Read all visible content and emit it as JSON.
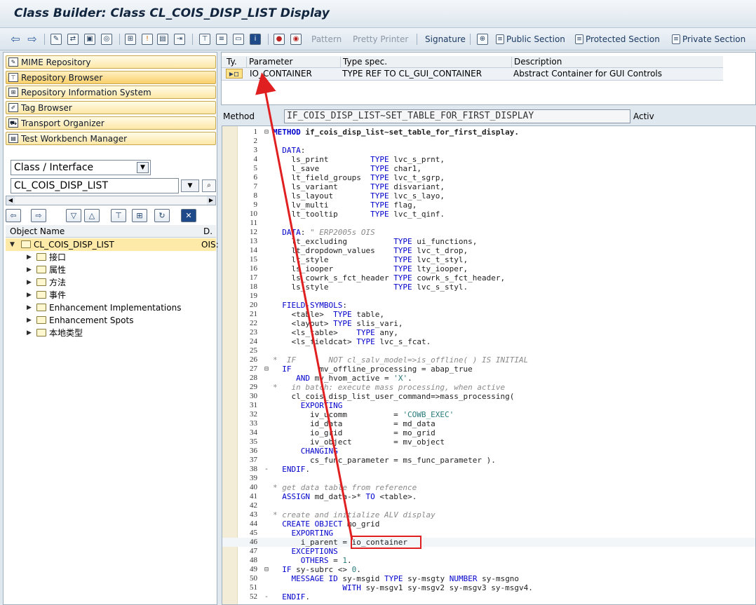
{
  "title": "Class Builder: Class CL_COIS_DISP_LIST Display",
  "toolbar": {
    "pattern": "Pattern",
    "pretty_printer": "Pretty Printer",
    "signature": "Signature",
    "public_section": "Public Section",
    "protected_section": "Protected Section",
    "private_section": "Private Section"
  },
  "nav": [
    {
      "label": "MIME Repository"
    },
    {
      "label": "Repository Browser"
    },
    {
      "label": "Repository Information System"
    },
    {
      "label": "Tag Browser"
    },
    {
      "label": "Transport Organizer"
    },
    {
      "label": "Test Workbench Manager"
    }
  ],
  "browser": {
    "object_type": "Class / Interface",
    "object_name": "CL_COIS_DISP_LIST"
  },
  "tree": {
    "col_name": "Object Name",
    "col_desc": "D.",
    "root": {
      "label": "CL_COIS_DISP_LIST",
      "desc": "OIS:"
    },
    "children": [
      {
        "label": "接口"
      },
      {
        "label": "属性"
      },
      {
        "label": "方法"
      },
      {
        "label": "事件"
      },
      {
        "label": "Enhancement Implementations"
      },
      {
        "label": "Enhancement Spots"
      },
      {
        "label": "本地类型"
      }
    ]
  },
  "params": {
    "headers": {
      "ty": "Ty.",
      "parameter": "Parameter",
      "type_spec": "Type spec.",
      "description": "Description"
    },
    "rows": [
      {
        "parameter": "IO_CONTAINER",
        "type_spec": "TYPE REF TO CL_GUI_CONTAINER",
        "description": "Abstract Container for GUI Controls"
      }
    ]
  },
  "method": {
    "label": "Method",
    "name": "IF_COIS_DISP_LIST~SET_TABLE_FOR_FIRST_DISPLAY",
    "status": "Activ"
  },
  "code_lines": [
    {
      "n": "1",
      "mk": "⊟",
      "t": "METHOD if_cois_disp_list~set_table_for_first_display."
    },
    {
      "n": "2",
      "mk": "",
      "t": ""
    },
    {
      "n": "3",
      "mk": "",
      "t": "  DATA:"
    },
    {
      "n": "4",
      "mk": "",
      "t": "    ls_print         TYPE lvc_s_prnt,"
    },
    {
      "n": "5",
      "mk": "",
      "t": "    l_save           TYPE char1,"
    },
    {
      "n": "6",
      "mk": "",
      "t": "    lt_field_groups  TYPE lvc_t_sgrp,"
    },
    {
      "n": "7",
      "mk": "",
      "t": "    ls_variant       TYPE disvariant,"
    },
    {
      "n": "8",
      "mk": "",
      "t": "    ls_layout        TYPE lvc_s_layo,"
    },
    {
      "n": "9",
      "mk": "",
      "t": "    lv_multi         TYPE flag,"
    },
    {
      "n": "10",
      "mk": "",
      "t": "    lt_tooltip       TYPE lvc_t_qinf."
    },
    {
      "n": "11",
      "mk": "",
      "t": ""
    },
    {
      "n": "12",
      "mk": "",
      "t": "  DATA: \" ERP2005s OIS"
    },
    {
      "n": "13",
      "mk": "",
      "t": "    lt_excluding          TYPE ui_functions,"
    },
    {
      "n": "14",
      "mk": "",
      "t": "    lt_dropdown_values    TYPE lvc_t_drop,"
    },
    {
      "n": "15",
      "mk": "",
      "t": "    lt_style              TYPE lvc_t_styl,"
    },
    {
      "n": "16",
      "mk": "",
      "t": "    ls_iooper             TYPE lty_iooper,"
    },
    {
      "n": "17",
      "mk": "",
      "t": "    ls_cowrk_s_fct_header TYPE cowrk_s_fct_header,"
    },
    {
      "n": "18",
      "mk": "",
      "t": "    ls_style              TYPE lvc_s_styl."
    },
    {
      "n": "19",
      "mk": "",
      "t": ""
    },
    {
      "n": "20",
      "mk": "",
      "t": "  FIELD-SYMBOLS:"
    },
    {
      "n": "21",
      "mk": "",
      "t": "    <table>  TYPE table,"
    },
    {
      "n": "22",
      "mk": "",
      "t": "    <layout> TYPE slis_vari,"
    },
    {
      "n": "23",
      "mk": "",
      "t": "    <ls_table>    TYPE any,"
    },
    {
      "n": "24",
      "mk": "",
      "t": "    <ls_fieldcat> TYPE lvc_s_fcat."
    },
    {
      "n": "25",
      "mk": "",
      "t": ""
    },
    {
      "n": "26",
      "mk": "",
      "t": "*  IF       NOT cl_salv_model=>is_offline( ) IS INITIAL"
    },
    {
      "n": "27",
      "mk": "⊟",
      "t": "  IF      mv_offline_processing = abap_true"
    },
    {
      "n": "28",
      "mk": "",
      "t": "     AND mv_hvom_active = 'X'."
    },
    {
      "n": "29",
      "mk": "",
      "t": "*   in batch: execute mass processing, when active"
    },
    {
      "n": "30",
      "mk": "",
      "t": "    cl_cois_disp_list_user_command=>mass_processing("
    },
    {
      "n": "31",
      "mk": "",
      "t": "      EXPORTING"
    },
    {
      "n": "32",
      "mk": "",
      "t": "        iv_ucomm          = 'COWB_EXEC'"
    },
    {
      "n": "33",
      "mk": "",
      "t": "        id_data           = md_data"
    },
    {
      "n": "34",
      "mk": "",
      "t": "        io_grid           = mo_grid"
    },
    {
      "n": "35",
      "mk": "",
      "t": "        iv_object         = mv_object"
    },
    {
      "n": "36",
      "mk": "",
      "t": "      CHANGING"
    },
    {
      "n": "37",
      "mk": "",
      "t": "        cs_func_parameter = ms_func_parameter )."
    },
    {
      "n": "38",
      "mk": "-",
      "t": "  ENDIF."
    },
    {
      "n": "39",
      "mk": "",
      "t": ""
    },
    {
      "n": "40",
      "mk": "",
      "t": "* get data table from reference"
    },
    {
      "n": "41",
      "mk": "",
      "t": "  ASSIGN md_data->* TO <table>."
    },
    {
      "n": "42",
      "mk": "",
      "t": ""
    },
    {
      "n": "43",
      "mk": "",
      "t": "* create and initialize ALV display"
    },
    {
      "n": "44",
      "mk": "",
      "t": "  CREATE OBJECT mo_grid"
    },
    {
      "n": "45",
      "mk": "",
      "t": "    EXPORTING"
    },
    {
      "n": "46",
      "mk": "",
      "t": "      i_parent = io_container"
    },
    {
      "n": "47",
      "mk": "",
      "t": "    EXCEPTIONS"
    },
    {
      "n": "48",
      "mk": "",
      "t": "      OTHERS = 1."
    },
    {
      "n": "49",
      "mk": "⊟",
      "t": "  IF sy-subrc <> 0."
    },
    {
      "n": "50",
      "mk": "",
      "t": "    MESSAGE ID sy-msgid TYPE sy-msgty NUMBER sy-msgno"
    },
    {
      "n": "51",
      "mk": "",
      "t": "               WITH sy-msgv1 sy-msgv2 sy-msgv3 sy-msgv4."
    },
    {
      "n": "52",
      "mk": "-",
      "t": "  ENDIF."
    }
  ],
  "colors": {
    "annotation": "#e02020",
    "keyword": "#0000cc",
    "comment": "#8a8a8a"
  }
}
